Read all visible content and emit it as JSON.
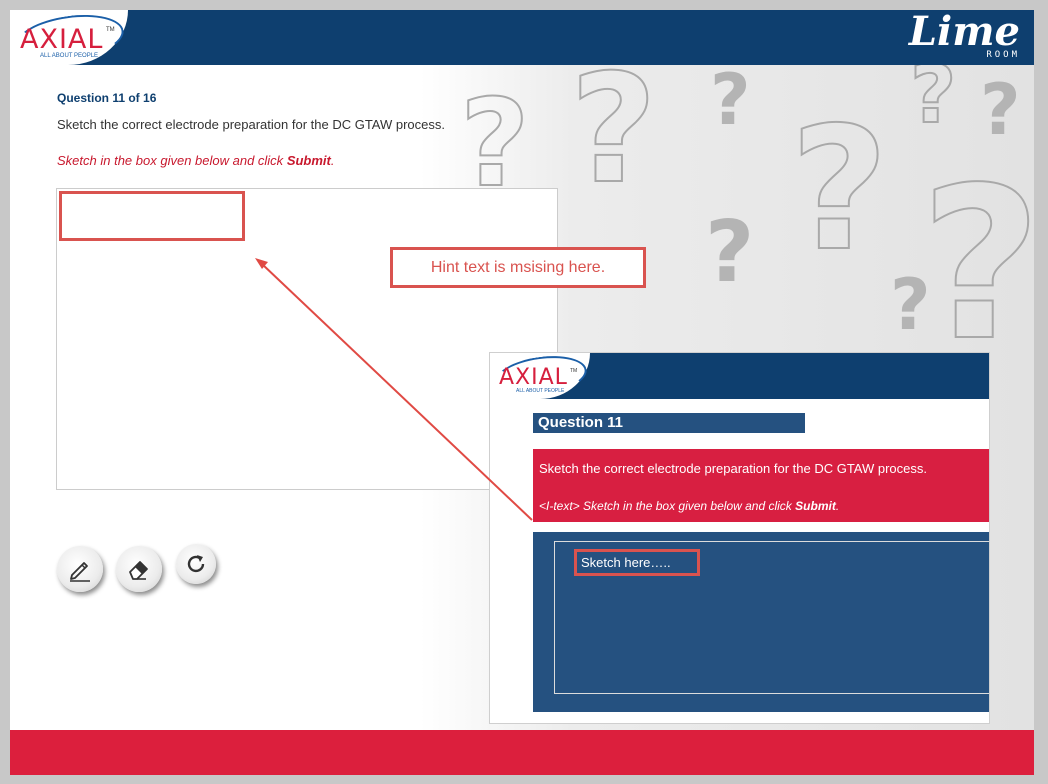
{
  "header": {
    "logo_text": "AXIAL",
    "logo_tm": "TM",
    "logo_tagline": "ALL ABOUT PEOPLE",
    "brand_name": "Lime",
    "brand_sub": "ROOM",
    "bar_color": "#0e3f6f"
  },
  "question": {
    "number_label": "Question 11 of 16",
    "text": "Sketch the correct electrode preparation for the DC GTAW process.",
    "instruction_prefix": "Sketch in the box given below and click ",
    "instruction_action": "Submit",
    "instruction_suffix": "."
  },
  "sketch": {
    "hint_text": ""
  },
  "tools": {
    "pencil_icon": "pencil-icon",
    "eraser_icon": "eraser-icon",
    "reset_icon": "reset-icon"
  },
  "annotation": {
    "callout_text": "Hint text is msising here.",
    "color": "#d9534f"
  },
  "reference": {
    "logo_text": "AXIAL",
    "logo_tm": "TM",
    "logo_tagline": "ALL ABOUT PEOPLE",
    "question_title": "Question 11",
    "question_text": "Sketch the correct electrode preparation for the DC GTAW process.",
    "instruction_prefix": "<I-text> Sketch in the box given below and click ",
    "instruction_action": "Submit",
    "instruction_suffix": ".",
    "placeholder": "Sketch here….."
  },
  "footer": {
    "color": "#dc1f3d"
  }
}
